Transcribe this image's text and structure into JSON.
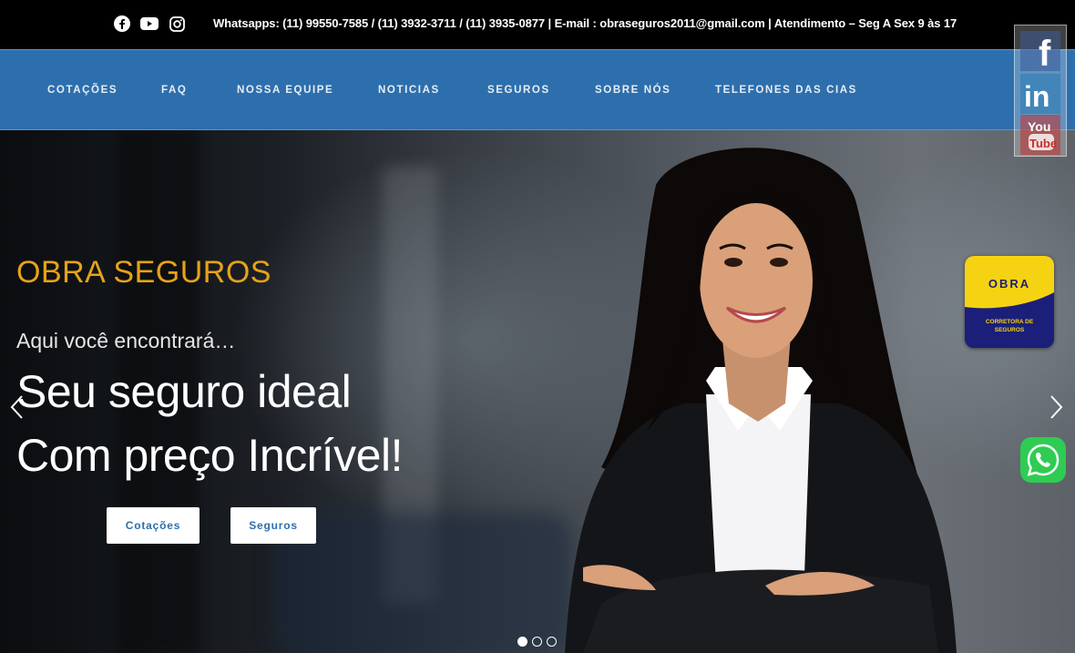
{
  "topbar": {
    "social": [
      {
        "icon": "facebook-icon"
      },
      {
        "icon": "youtube-icon"
      },
      {
        "icon": "instagram-icon"
      }
    ],
    "contact": "Whatsapps: (11) 99550-7585 / (11) 3932-3711 / (11) 3935-0877   |   E-mail : obraseguros2011@gmail.com | Atendimento – Seg A Sex 9 às 17"
  },
  "nav": {
    "items": [
      {
        "label": "COTAÇÕES"
      },
      {
        "label": "FAQ"
      },
      {
        "label": "NOSSA EQUIPE"
      },
      {
        "label": "NOTICIAS"
      },
      {
        "label": "SEGUROS"
      },
      {
        "label": "SOBRE NÓS"
      },
      {
        "label": "TELEFONES DAS CIAS"
      }
    ]
  },
  "hero": {
    "brand": "OBRA SEGUROS",
    "subtitle": "Aqui você encontrará…",
    "line1": "Seu seguro ideal",
    "line2": "Com preço Incrível!",
    "buttons": [
      {
        "label": "Cotações"
      },
      {
        "label": "Seguros"
      }
    ],
    "slides_total": 3,
    "active_slide": 1
  },
  "float_social": {
    "facebook": "f",
    "linkedin": "in",
    "youtube_top": "You",
    "youtube_bottom": "Tube"
  },
  "badge": {
    "title": "OBRA",
    "subtitle_1": "CORRETORA DE",
    "subtitle_2": "SEGUROS"
  },
  "colors": {
    "nav_bg": "#2d6fad",
    "brand_orange": "#e6a21a",
    "badge_yellow": "#f5d312",
    "badge_navy": "#1b1f7a",
    "whatsapp_green": "#2ecc52"
  }
}
